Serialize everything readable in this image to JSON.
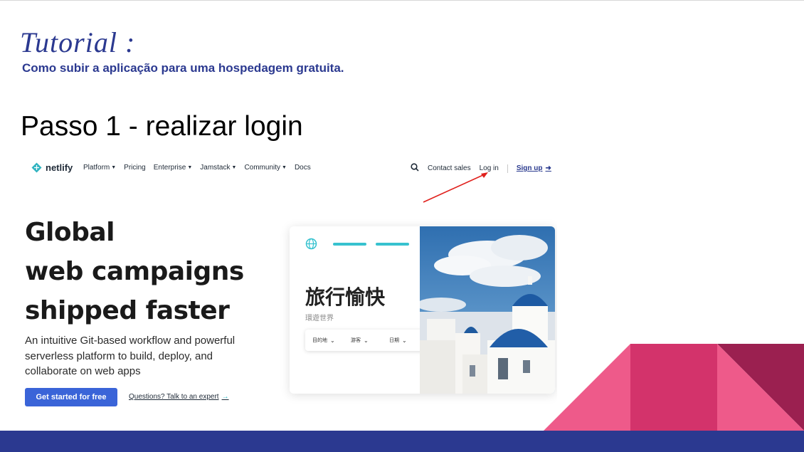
{
  "slide": {
    "title": "Tutorial :",
    "subtitle": "Como subir a aplicação para uma hospedagem gratuita.",
    "step_heading": "Passo 1 - realizar login"
  },
  "netlify": {
    "logo_text": "netlify",
    "nav_items": [
      {
        "label": "Platform",
        "dropdown": true
      },
      {
        "label": "Pricing",
        "dropdown": false
      },
      {
        "label": "Enterprise",
        "dropdown": true
      },
      {
        "label": "Jamstack",
        "dropdown": true
      },
      {
        "label": "Community",
        "dropdown": true
      },
      {
        "label": "Docs",
        "dropdown": false
      }
    ],
    "contact_sales": "Contact sales",
    "login": "Log in",
    "signup": "Sign up",
    "hero_lines": [
      "Global",
      "web campaigns",
      "shipped faster"
    ],
    "hero_description": "An intuitive Git-based workflow and powerful serverless platform to build, deploy, and collaborate on web apps",
    "cta_button": "Get started for free",
    "expert_link": "Questions? Talk to an expert",
    "card": {
      "title": "旅行愉快",
      "subtitle": "環遊世界",
      "fields": [
        "目的地",
        "游客",
        "日期"
      ]
    }
  },
  "colors": {
    "brand_blue": "#2b3990",
    "teal": "#37c2cf",
    "cta_blue": "#3a64d8",
    "pink": "#ee5a8a",
    "magenta": "#d3336b",
    "maroon": "#9b2050",
    "arrow_red": "#e0201c"
  },
  "icons": [
    "netlify-logo-icon",
    "search-icon",
    "arrow-right-icon",
    "globe-icon",
    "chevron-down-icon"
  ]
}
